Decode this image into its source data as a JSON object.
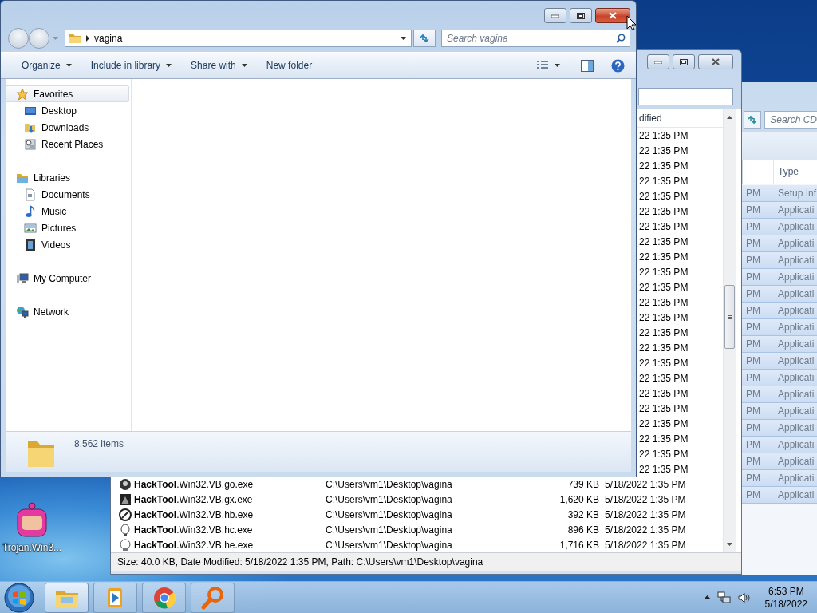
{
  "desktop": {
    "icons": [
      {
        "label": "Trojan.Win3..."
      }
    ]
  },
  "back_window": {
    "search": {
      "placeholder": "Search CD"
    },
    "column_header": "Type",
    "rows": [
      {
        "column_1": "PM",
        "type": "Setup Inf",
        "selected": true
      },
      {
        "column_1": "PM",
        "type": "Applicati",
        "selected": true
      },
      {
        "column_1": "PM",
        "type": "Applicati",
        "selected": true
      },
      {
        "column_1": "PM",
        "type": "Applicati",
        "selected": true
      },
      {
        "column_1": "PM",
        "type": "Applicati",
        "selected": true
      },
      {
        "column_1": "PM",
        "type": "Applicati",
        "selected": true
      },
      {
        "column_1": "PM",
        "type": "Applicati",
        "selected": true
      },
      {
        "column_1": "PM",
        "type": "Applicati",
        "selected": true
      },
      {
        "column_1": "PM",
        "type": "Applicati",
        "selected": true
      },
      {
        "column_1": "PM",
        "type": "Applicati",
        "selected": true
      },
      {
        "column_1": "PM",
        "type": "Applicati",
        "selected": true
      },
      {
        "column_1": "PM",
        "type": "Applicati",
        "selected": true
      },
      {
        "column_1": "PM",
        "type": "Applicati",
        "selected": true
      },
      {
        "column_1": "PM",
        "type": "Applicati",
        "selected": true
      },
      {
        "column_1": "PM",
        "type": "Applicati",
        "selected": true
      },
      {
        "column_1": "PM",
        "type": "Applicati",
        "selected": true
      },
      {
        "column_1": "PM",
        "type": "Applicati",
        "selected": true
      },
      {
        "column_1": "PM",
        "type": "Applicati",
        "selected": true
      },
      {
        "column_1": "PM",
        "type": "Applicati",
        "selected": true
      }
    ]
  },
  "middle_window": {
    "column_header": "dified",
    "rows": [
      {
        "kind": "covered",
        "date": "22 1:35 PM"
      },
      {
        "kind": "covered",
        "date": "22 1:35 PM"
      },
      {
        "kind": "covered",
        "date": "22 1:35 PM"
      },
      {
        "kind": "covered",
        "date": "22 1:35 PM"
      },
      {
        "kind": "covered",
        "date": "22 1:35 PM"
      },
      {
        "kind": "covered",
        "date": "22 1:35 PM"
      },
      {
        "kind": "covered",
        "date": "22 1:35 PM"
      },
      {
        "kind": "covered",
        "date": "22 1:35 PM"
      },
      {
        "kind": "covered",
        "date": "22 1:35 PM"
      },
      {
        "kind": "covered",
        "date": "22 1:35 PM"
      },
      {
        "kind": "covered",
        "date": "22 1:35 PM"
      },
      {
        "kind": "covered",
        "date": "22 1:35 PM"
      },
      {
        "kind": "covered",
        "date": "22 1:35 PM"
      },
      {
        "kind": "covered",
        "date": "22 1:35 PM"
      },
      {
        "kind": "covered",
        "date": "22 1:35 PM"
      },
      {
        "kind": "covered",
        "date": "22 1:35 PM"
      },
      {
        "kind": "covered",
        "date": "22 1:35 PM"
      },
      {
        "kind": "covered",
        "date": "22 1:35 PM"
      },
      {
        "kind": "covered",
        "date": "22 1:35 PM"
      },
      {
        "kind": "covered",
        "date": "22 1:35 PM"
      },
      {
        "kind": "covered",
        "date": "22 1:35 PM"
      },
      {
        "kind": "covered",
        "date": "22 1:35 PM"
      },
      {
        "kind": "covered",
        "date": "22 1:35 PM"
      },
      {
        "kind": "file",
        "name": "**HackTool**.Win32.VB.go.exe",
        "path": "C:\\Users\\vm1\\Desktop\\vagina",
        "size": "739 KB",
        "date": "5/18/2022 1:35 PM"
      },
      {
        "kind": "file",
        "name": "**HackTool**.Win32.VB.gx.exe",
        "path": "C:\\Users\\vm1\\Desktop\\vagina",
        "size": "1,620 KB",
        "date": "5/18/2022 1:35 PM"
      },
      {
        "kind": "file",
        "name": "**HackTool**.Win32.VB.hb.exe",
        "path": "C:\\Users\\vm1\\Desktop\\vagina",
        "size": "392 KB",
        "date": "5/18/2022 1:35 PM"
      },
      {
        "kind": "file",
        "name": "**HackTool**.Win32.VB.hc.exe",
        "path": "C:\\Users\\vm1\\Desktop\\vagina",
        "size": "896 KB",
        "date": "5/18/2022 1:35 PM"
      },
      {
        "kind": "file",
        "name": "**HackTool**.Win32.VB.he.exe",
        "path": "C:\\Users\\vm1\\Desktop\\vagina",
        "size": "1,716 KB",
        "date": "5/18/2022 1:35 PM"
      }
    ],
    "status": "Size: 40.0 KB, Date Modified: 5/18/2022 1:35 PM, Path: C:\\Users\\vm1\\Desktop\\vagina"
  },
  "front_window": {
    "address": {
      "segment": "vagina"
    },
    "search": {
      "placeholder": "Search vagina"
    },
    "toolbar": [
      {
        "label": "Organize",
        "dropdown": true
      },
      {
        "label": "Include in library",
        "dropdown": true
      },
      {
        "label": "Share with",
        "dropdown": true
      },
      {
        "label": "New folder",
        "dropdown": false
      }
    ],
    "navigation": [
      {
        "label": "Favorites",
        "kind": "favorites",
        "selected": true,
        "children": [
          {
            "label": "Desktop",
            "kind": "desktop",
            "selected": false
          },
          {
            "label": "Downloads",
            "kind": "downloads",
            "selected": false
          },
          {
            "label": "Recent Places",
            "kind": "recent",
            "selected": false
          }
        ]
      },
      {
        "label": "Libraries",
        "kind": "libraries",
        "selected": false,
        "children": [
          {
            "label": "Documents",
            "kind": "documents",
            "selected": false
          },
          {
            "label": "Music",
            "kind": "music",
            "selected": false
          },
          {
            "label": "Pictures",
            "kind": "pictures",
            "selected": false
          },
          {
            "label": "Videos",
            "kind": "videos",
            "selected": false
          }
        ]
      },
      {
        "label": "My Computer",
        "kind": "computer",
        "selected": false
      },
      {
        "label": "Network",
        "kind": "network",
        "selected": false
      }
    ],
    "details": {
      "item_count": "8,562 items"
    }
  },
  "taskbar": {
    "apps": [
      {
        "kind": "explorer",
        "active": true
      },
      {
        "kind": "media",
        "active": false
      },
      {
        "kind": "browser",
        "active": false
      },
      {
        "kind": "magnifier",
        "active": false
      }
    ],
    "clock": {
      "time": "6:53 PM",
      "date": "5/18/2022"
    }
  }
}
